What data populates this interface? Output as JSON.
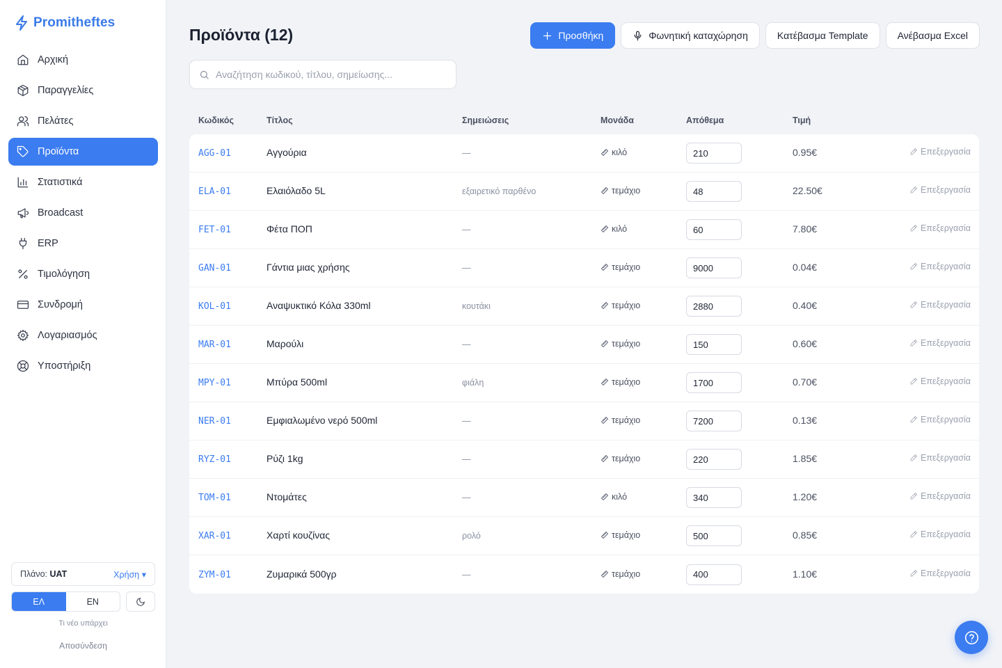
{
  "brand": {
    "name": "Promitheftes",
    "icon": "bolt-icon",
    "color": "#3b7be8"
  },
  "sidebar": {
    "items": [
      {
        "label": "Αρχική",
        "icon": "home-icon",
        "active": false
      },
      {
        "label": "Παραγγελίες",
        "icon": "package-icon",
        "active": false
      },
      {
        "label": "Πελάτες",
        "icon": "users-icon",
        "active": false
      },
      {
        "label": "Προϊόντα",
        "icon": "tag-icon",
        "active": true
      },
      {
        "label": "Στατιστικά",
        "icon": "bar-chart-icon",
        "active": false
      },
      {
        "label": "Broadcast",
        "icon": "megaphone-icon",
        "active": false
      },
      {
        "label": "ERP",
        "icon": "plug-icon",
        "active": false
      },
      {
        "label": "Τιμολόγηση",
        "icon": "percent-icon",
        "active": false
      },
      {
        "label": "Συνδρομή",
        "icon": "credit-card-icon",
        "active": false
      },
      {
        "label": "Λογαριασμός",
        "icon": "gear-icon",
        "active": false
      },
      {
        "label": "Υποστήριξη",
        "icon": "lifebuoy-icon",
        "active": false
      }
    ],
    "plan": {
      "label": "Πλάνο:",
      "value": "UAT",
      "usage_link": "Χρήση ▾"
    },
    "language": {
      "el": "ΕΛ",
      "en": "EN",
      "selected": "ΕΛ"
    },
    "theme_icon": "moon-icon",
    "whats_new": "Τι νέο υπάρχει",
    "logout": "Αποσύνδεση"
  },
  "header": {
    "title": "Προϊόντα (12)",
    "buttons": {
      "add": "Προσθήκη",
      "voice": "Φωνητική καταχώρηση",
      "download_template": "Κατέβασμα Template",
      "upload_excel": "Ανέβασμα Excel"
    }
  },
  "search": {
    "placeholder": "Αναζήτηση κωδικού, τίτλου, σημείωσης...",
    "value": ""
  },
  "table": {
    "columns": [
      "Κωδικός",
      "Τίτλος",
      "Σημειώσεις",
      "Μονάδα",
      "Απόθεμα",
      "Τιμή"
    ],
    "edit_label": "Επεξεργασία",
    "rows": [
      {
        "code": "AGG-01",
        "title": "Αγγούρια",
        "notes": "—",
        "unit": "κιλό",
        "stock": "210",
        "price": "0.95€"
      },
      {
        "code": "ELA-01",
        "title": "Ελαιόλαδο 5L",
        "notes": "εξαιρετικό παρθένο",
        "unit": "τεμάχιο",
        "stock": "48",
        "price": "22.50€"
      },
      {
        "code": "FET-01",
        "title": "Φέτα ΠΟΠ",
        "notes": "—",
        "unit": "κιλό",
        "stock": "60",
        "price": "7.80€"
      },
      {
        "code": "GAN-01",
        "title": "Γάντια μιας χρήσης",
        "notes": "—",
        "unit": "τεμάχιο",
        "stock": "9000",
        "price": "0.04€"
      },
      {
        "code": "KOL-01",
        "title": "Αναψυκτικό Κόλα 330ml",
        "notes": "κουτάκι",
        "unit": "τεμάχιο",
        "stock": "2880",
        "price": "0.40€"
      },
      {
        "code": "MAR-01",
        "title": "Μαρούλι",
        "notes": "—",
        "unit": "τεμάχιο",
        "stock": "150",
        "price": "0.60€"
      },
      {
        "code": "MPY-01",
        "title": "Μπύρα 500ml",
        "notes": "φιάλη",
        "unit": "τεμάχιο",
        "stock": "1700",
        "price": "0.70€"
      },
      {
        "code": "NER-01",
        "title": "Εμφιαλωμένο νερό 500ml",
        "notes": "—",
        "unit": "τεμάχιο",
        "stock": "7200",
        "price": "0.13€"
      },
      {
        "code": "RYZ-01",
        "title": "Ρύζι 1kg",
        "notes": "—",
        "unit": "τεμάχιο",
        "stock": "220",
        "price": "1.85€"
      },
      {
        "code": "TOM-01",
        "title": "Ντομάτες",
        "notes": "—",
        "unit": "κιλό",
        "stock": "340",
        "price": "1.20€"
      },
      {
        "code": "XAR-01",
        "title": "Χαρτί κουζίνας",
        "notes": "ρολό",
        "unit": "τεμάχιο",
        "stock": "500",
        "price": "0.85€"
      },
      {
        "code": "ZYM-01",
        "title": "Ζυμαρικά 500γρ",
        "notes": "—",
        "unit": "τεμάχιο",
        "stock": "400",
        "price": "1.10€"
      }
    ]
  },
  "help_button_icon": "help-circle-icon",
  "colors": {
    "accent": "#3b7cf0",
    "background": "#f1f3f7",
    "sidebar": "#ffffff"
  }
}
